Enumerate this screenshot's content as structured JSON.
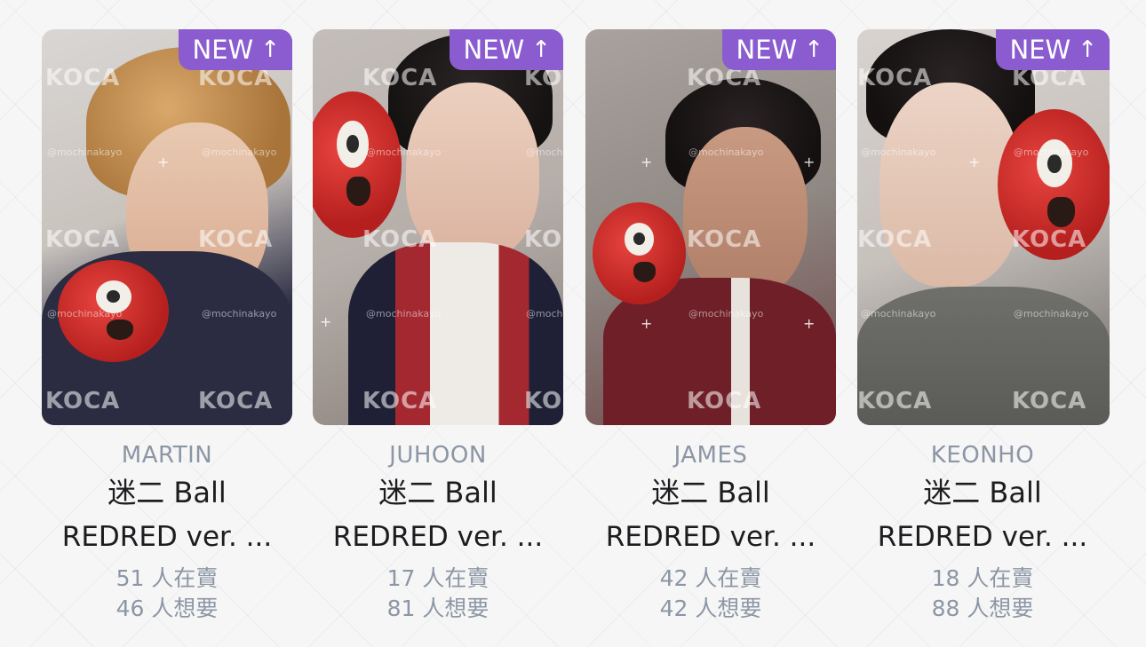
{
  "badge": {
    "label": "NEW",
    "arrow": "↑",
    "icon": "arrow-up-icon",
    "color": "#8a5ccf"
  },
  "watermark": {
    "logo": "KOCA",
    "handle": "@mochinakayo"
  },
  "cards": [
    {
      "name": "MARTIN",
      "title1": "迷二 Ball",
      "title2": "REDRED ver. ...",
      "selling": "51 人在賣",
      "wanting": "46 人想要"
    },
    {
      "name": "JUHOON",
      "title1": "迷二 Ball",
      "title2": "REDRED ver. ...",
      "selling": "17 人在賣",
      "wanting": "81 人想要"
    },
    {
      "name": "JAMES",
      "title1": "迷二 Ball",
      "title2": "REDRED ver. ...",
      "selling": "42 人在賣",
      "wanting": "42 人想要"
    },
    {
      "name": "KEONHO",
      "title1": "迷二 Ball",
      "title2": "REDRED ver. ...",
      "selling": "18 人在賣",
      "wanting": "88 人想要"
    }
  ],
  "colors": {
    "badge_purple": "#8a5ccf",
    "name_gray": "#8c96a4",
    "text_dark": "#1d1d1f",
    "plush_red": "#d4302b"
  }
}
